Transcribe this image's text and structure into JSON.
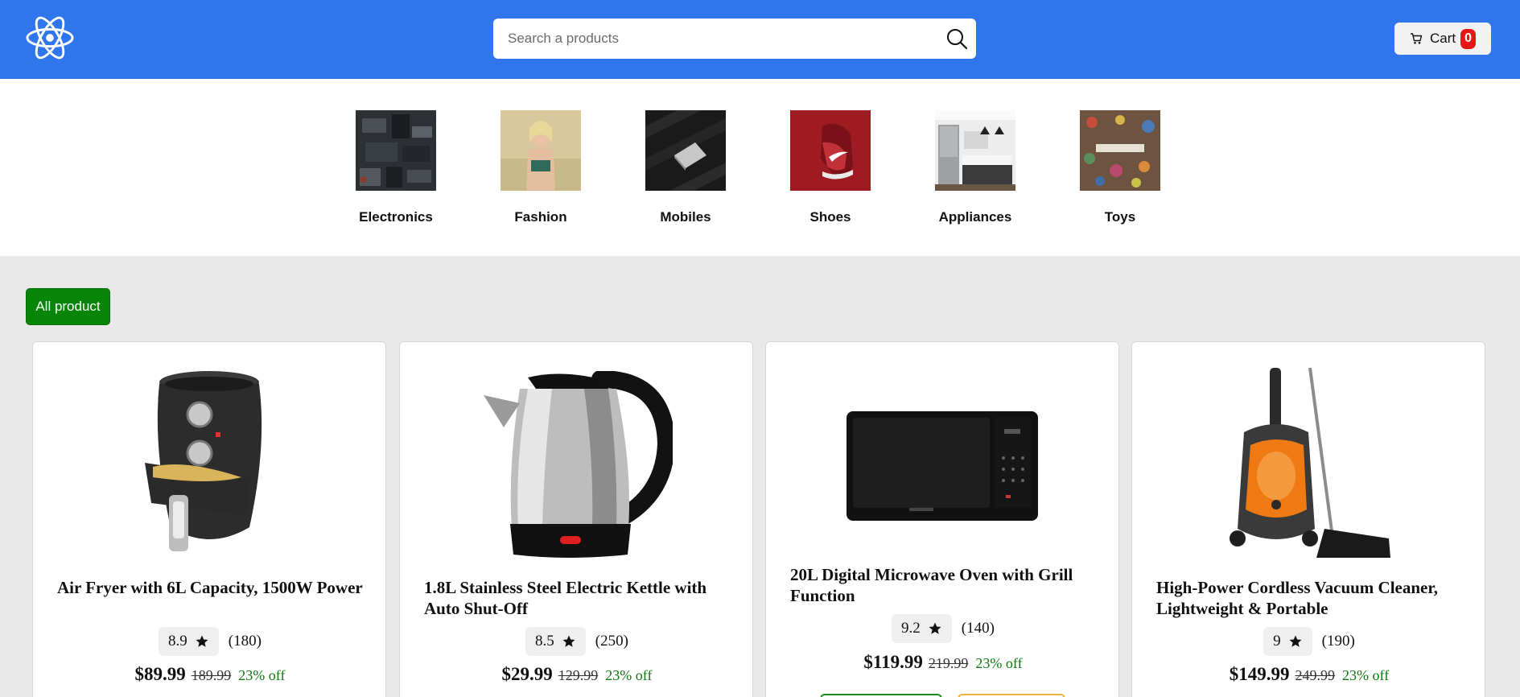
{
  "header": {
    "search_placeholder": "Search a products",
    "cart_label": "Cart",
    "cart_count": "0"
  },
  "categories": [
    {
      "label": "Electronics"
    },
    {
      "label": "Fashion"
    },
    {
      "label": "Mobiles"
    },
    {
      "label": "Shoes"
    },
    {
      "label": "Appliances"
    },
    {
      "label": "Toys"
    }
  ],
  "filter": {
    "all_label": "All product"
  },
  "products": [
    {
      "title": "Air Fryer with 6L Capacity, 1500W Power",
      "rating": "8.9",
      "reviews": "(180)",
      "price": "$89.99",
      "old_price": "189.99",
      "discount": "23% off"
    },
    {
      "title": "1.8L Stainless Steel Electric Kettle with Auto Shut-Off",
      "rating": "8.5",
      "reviews": "(250)",
      "price": "$29.99",
      "old_price": "129.99",
      "discount": "23% off"
    },
    {
      "title": "20L Digital Microwave Oven with Grill Function",
      "rating": "9.2",
      "reviews": "(140)",
      "price": "$119.99",
      "old_price": "219.99",
      "discount": "23% off"
    },
    {
      "title": "High-Power Cordless Vacuum Cleaner, Lightweight & Portable",
      "rating": "9",
      "reviews": "(190)",
      "price": "$149.99",
      "old_price": "249.99",
      "discount": "23% off"
    }
  ],
  "colors": {
    "header_bg": "#2f76ec",
    "cart_badge": "#e81717",
    "all_button": "#078507",
    "discount": "#0c7a0c"
  },
  "icons": {
    "logo": "react-atom-icon",
    "search": "search-icon",
    "cart": "cart-icon",
    "star": "star-icon"
  }
}
